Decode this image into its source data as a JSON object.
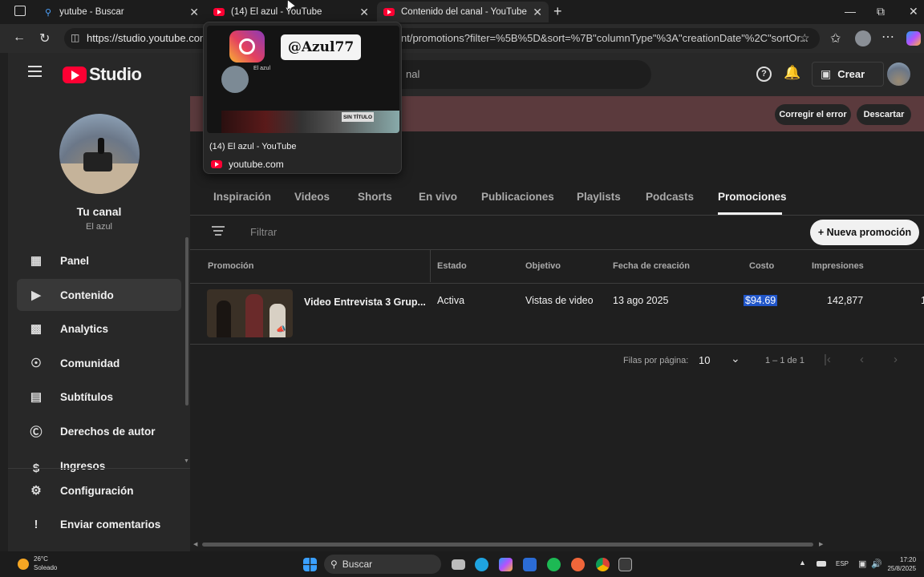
{
  "browser": {
    "tabs": [
      {
        "title": "yutube - Buscar"
      },
      {
        "title": "(14) El azul - YouTube"
      },
      {
        "title": "Contenido del canal - YouTube St"
      }
    ],
    "url": "https://studio.youtube.com",
    "url_tail": "nt/promotions?filter=%5B%5D&sort=%7B\"columnType\"%3A\"creationDate\"%2C\"sortOr..."
  },
  "preview": {
    "tag": "@Azul77",
    "channel": "El azul",
    "sin_titulo": "SIN TÍTULO",
    "title": "(14) El azul - YouTube",
    "domain": "youtube.com"
  },
  "header": {
    "logo_text": "Studio",
    "search_placeholder": "nal",
    "create_label": "Crear"
  },
  "banner": {
    "fix_label": "Corregir el error",
    "dismiss_label": "Descartar"
  },
  "sidebar": {
    "channel_title": "Tu canal",
    "channel_name": "El azul",
    "items": [
      {
        "label": "Panel"
      },
      {
        "label": "Contenido"
      },
      {
        "label": "Analytics"
      },
      {
        "label": "Comunidad"
      },
      {
        "label": "Subtítulos"
      },
      {
        "label": "Derechos de autor"
      },
      {
        "label": "Ingresos"
      }
    ],
    "bottom": [
      {
        "label": "Configuración"
      },
      {
        "label": "Enviar comentarios"
      }
    ]
  },
  "main": {
    "tabs": [
      "Inspiración",
      "Videos",
      "Shorts",
      "En vivo",
      "Publicaciones",
      "Playlists",
      "Podcasts",
      "Promociones"
    ],
    "filter_placeholder": "Filtrar",
    "new_promo_label": "+ Nueva promoción",
    "columns": [
      "Promoción",
      "Estado",
      "Objetivo",
      "Fecha de creación",
      "Costo",
      "Impresiones"
    ],
    "row": {
      "promo": "Video Entrevista 3 Grup...",
      "estado": "Activa",
      "objetivo": "Vistas de video",
      "fecha": "13 ago 2025",
      "costo": "$94.69",
      "impresiones": "142,877",
      "overflow": "1"
    },
    "pagination": {
      "rows_label": "Filas por página:",
      "rows_value": "10",
      "range": "1 – 1 de 1"
    }
  },
  "taskbar": {
    "temp": "26°C",
    "weather": "Soleado",
    "search_label": "Buscar",
    "lang": "ESP",
    "time": "17:20",
    "date": "25/8/2025"
  }
}
